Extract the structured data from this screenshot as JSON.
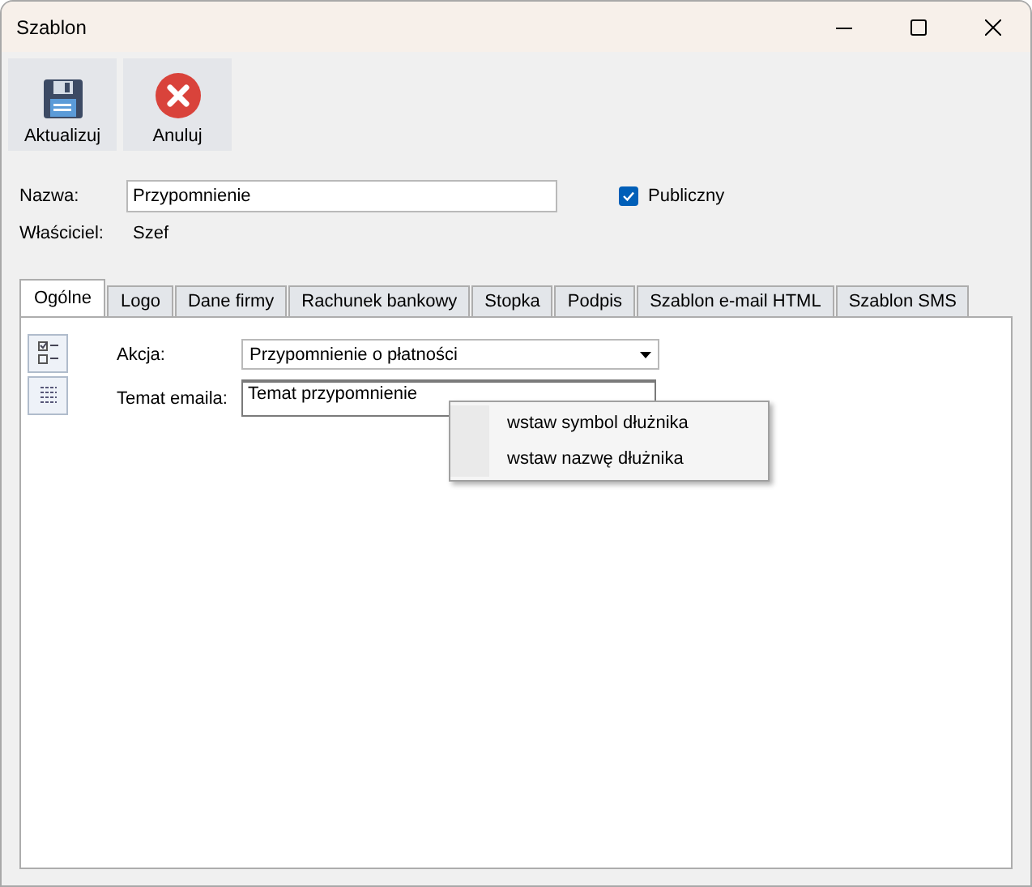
{
  "window": {
    "title": "Szablon"
  },
  "toolbar": [
    {
      "kind": "save",
      "label": "Aktualizuj"
    },
    {
      "kind": "cancel",
      "label": "Anuluj"
    }
  ],
  "name_field": {
    "label": "Nazwa:",
    "value": "Przypomnienie"
  },
  "public_checkbox": {
    "label": "Publiczny",
    "checked": true
  },
  "owner": {
    "label": "Właściciel:",
    "value": "Szef"
  },
  "tabs": [
    {
      "label": "Ogólne",
      "selected": true
    },
    {
      "label": "Logo",
      "selected": false
    },
    {
      "label": "Dane firmy",
      "selected": false
    },
    {
      "label": "Rachunek bankowy",
      "selected": false
    },
    {
      "label": "Stopka",
      "selected": false
    },
    {
      "label": "Podpis",
      "selected": false
    },
    {
      "label": "Szablon e-mail HTML",
      "selected": false
    },
    {
      "label": "Szablon SMS",
      "selected": false
    }
  ],
  "action": {
    "label": "Akcja:",
    "value": "Przypomnienie o płatności"
  },
  "subject": {
    "label": "Temat emaila:",
    "value": "Temat przypomnienie"
  },
  "context_menu": [
    "wstaw symbol dłużnika",
    "wstaw nazwę dłużnika"
  ]
}
